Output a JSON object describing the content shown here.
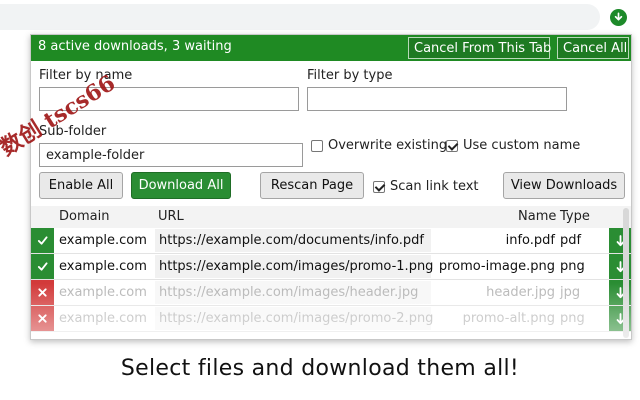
{
  "browser": {
    "extension_icon": "download-arrow-icon"
  },
  "popup": {
    "status_text": "8 active downloads, 3 waiting",
    "cancel_tab_label": "Cancel From This Tab",
    "cancel_all_label": "Cancel All",
    "filter_name_label": "Filter by name",
    "filter_name_value": "",
    "filter_type_label": "Filter by type",
    "filter_type_value": "",
    "subfolder_label": "Sub-folder",
    "subfolder_value": "example-folder",
    "overwrite_label": "Overwrite existing",
    "overwrite_checked": false,
    "custom_name_label": "Use custom name",
    "custom_name_checked": true,
    "enable_all_label": "Enable All",
    "download_all_label": "Download All",
    "rescan_label": "Rescan Page",
    "scan_link_label": "Scan link text",
    "scan_link_checked": true,
    "view_downloads_label": "View Downloads"
  },
  "table": {
    "headers": {
      "domain": "Domain",
      "url": "URL",
      "name": "Name",
      "type": "Type"
    },
    "rows": [
      {
        "status": "enabled",
        "status_icon": "check-icon",
        "domain": "example.com",
        "url": "https://example.com/documents/info.pdf",
        "name": "info.pdf",
        "type": "pdf"
      },
      {
        "status": "enabled",
        "status_icon": "check-icon",
        "domain": "example.com",
        "url": "https://example.com/images/promo-1.png",
        "name": "promo-image.png",
        "type": "png"
      },
      {
        "status": "disabled",
        "status_icon": "close-icon",
        "domain": "example.com",
        "url": "https://example.com/images/header.jpg",
        "name": "header.jpg",
        "type": "jpg"
      },
      {
        "status": "disabled",
        "status_icon": "close-icon",
        "domain": "example.com",
        "url": "https://example.com/images/promo-2.png",
        "name": "promo-alt.png",
        "type": "png"
      }
    ]
  },
  "watermark_text": "数创 tscs66",
  "caption": "Select files and download them all!",
  "colors": {
    "accent_green": "#2a8d33",
    "error_red": "#d23a3a"
  }
}
